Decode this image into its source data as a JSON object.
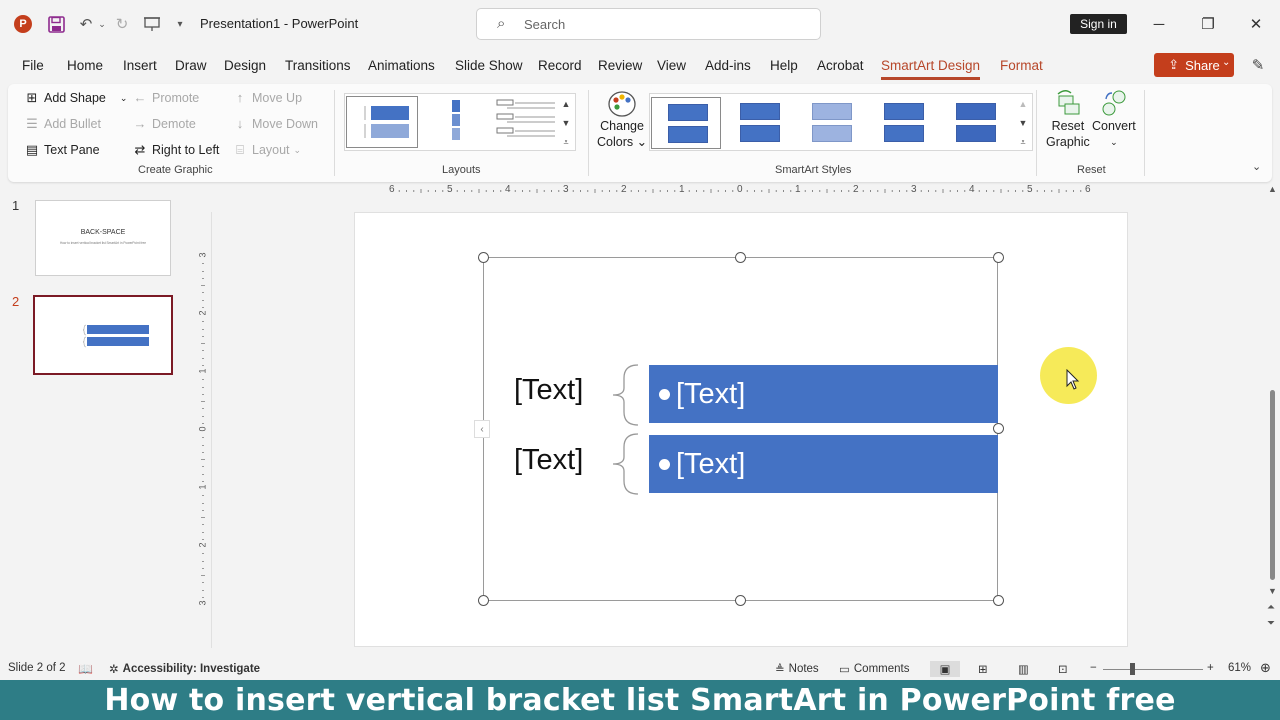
{
  "app": {
    "doc_title": "Presentation1  -  PowerPoint",
    "logo_letter": "P"
  },
  "search": {
    "placeholder": "Search"
  },
  "account": {
    "signin_label": "Sign in"
  },
  "tabs": [
    {
      "label": "File"
    },
    {
      "label": "Home"
    },
    {
      "label": "Insert"
    },
    {
      "label": "Draw"
    },
    {
      "label": "Design"
    },
    {
      "label": "Transitions"
    },
    {
      "label": "Animations"
    },
    {
      "label": "Slide Show"
    },
    {
      "label": "Record"
    },
    {
      "label": "Review"
    },
    {
      "label": "View"
    },
    {
      "label": "Add-ins"
    },
    {
      "label": "Help"
    },
    {
      "label": "Acrobat"
    },
    {
      "label": "SmartArt Design"
    },
    {
      "label": "Format"
    }
  ],
  "share": {
    "label": "Share"
  },
  "ribbon": {
    "create_graphic": {
      "add_shape": "Add Shape",
      "add_bullet": "Add Bullet",
      "text_pane": "Text Pane",
      "promote": "Promote",
      "demote": "Demote",
      "right_to_left": "Right to Left",
      "move_up": "Move Up",
      "move_down": "Move Down",
      "layout": "Layout",
      "label": "Create Graphic"
    },
    "layouts": {
      "label": "Layouts"
    },
    "styles": {
      "change_colors_1": "Change",
      "change_colors_2": "Colors",
      "label": "SmartArt Styles"
    },
    "reset": {
      "reset_graphic_1": "Reset",
      "reset_graphic_2": "Graphic",
      "convert": "Convert",
      "label": "Reset"
    }
  },
  "ruler": {
    "ticks": [
      "6",
      "5",
      "4",
      "3",
      "2",
      "1",
      "0",
      "1",
      "2",
      "3",
      "4",
      "5",
      "6"
    ],
    "vticks": [
      "3",
      "2",
      "1",
      "0",
      "1",
      "2",
      "3"
    ]
  },
  "slides": [
    {
      "number": "1",
      "title": "BACK-SPACE",
      "subtitle": "How to insert vertical bracket list SmartArt in PowerPoint free"
    },
    {
      "number": "2"
    }
  ],
  "smartart": {
    "rows": [
      {
        "label": "[Text]",
        "bullet": "[Text]"
      },
      {
        "label": "[Text]",
        "bullet": "[Text]"
      }
    ],
    "accent": "#4472c4"
  },
  "status": {
    "slide_of": "Slide 2 of 2",
    "accessibility": "Accessibility: Investigate",
    "notes": "Notes",
    "comments": "Comments",
    "zoom": "61%"
  },
  "caption": "How to insert vertical bracket list SmartArt in PowerPoint free"
}
